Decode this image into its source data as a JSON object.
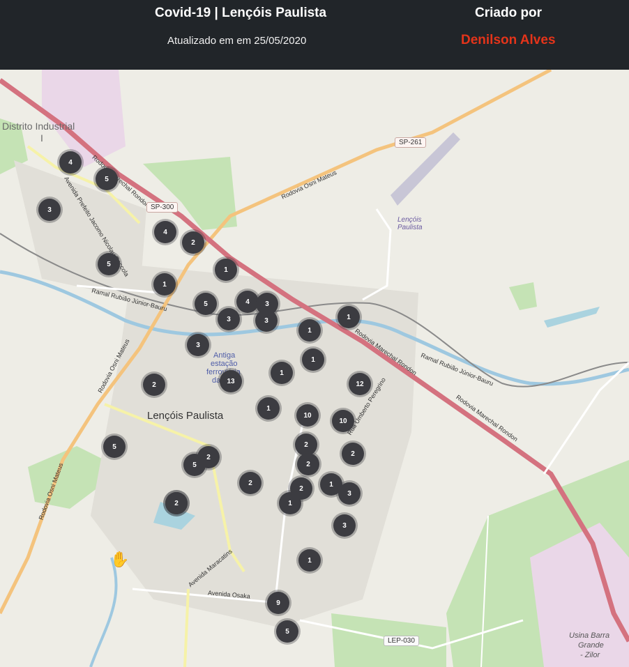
{
  "header": {
    "title": "Covid-19 | Lençóis Paulista",
    "updated": "Atualizado em em 25/05/2020",
    "created_by_label": "Criado por",
    "author": "Denilson Alves",
    "author_color": "#e4341a"
  },
  "map": {
    "labels": {
      "district": "Distrito Industrial",
      "district_num": "I",
      "city": "Lençóis Paulista",
      "station": [
        "Antiga",
        "estação",
        "ferroviária",
        "da F..."
      ],
      "airport": [
        "Lençóis",
        "Paulista"
      ],
      "usina": [
        "Usina Barra",
        "Grande",
        "- Zilor"
      ],
      "road_marechal": "Rodovia Marechal Rondon",
      "road_osni": "Rodovia Osni Mateus",
      "ramal": "Ramal Rubião Júnior-Bauru",
      "av_prefeito": "Avenida Prefeito Jacomo Nicolau Paccola",
      "av_maracatins": "Avenida Maracatins",
      "av_osaka": "Avenida Osaka",
      "rua_peregrino": "Rua Umberto Peregrino",
      "sp300": "SP-300",
      "sp261": "SP-261",
      "lep030": "LEP-030",
      "hand_icon": "hand-pointer-icon"
    },
    "clusters": [
      "4",
      "5",
      "3",
      "4",
      "2",
      "5",
      "1",
      "1",
      "5",
      "4",
      "3",
      "3",
      "3",
      "1",
      "1",
      "3",
      "1",
      "1",
      "2",
      "13",
      "12",
      "1",
      "10",
      "10",
      "5",
      "2",
      "5",
      "2",
      "2",
      "2",
      "2",
      "2",
      "1",
      "2",
      "1",
      "3",
      "2",
      "3",
      "1",
      "9",
      "5"
    ]
  }
}
